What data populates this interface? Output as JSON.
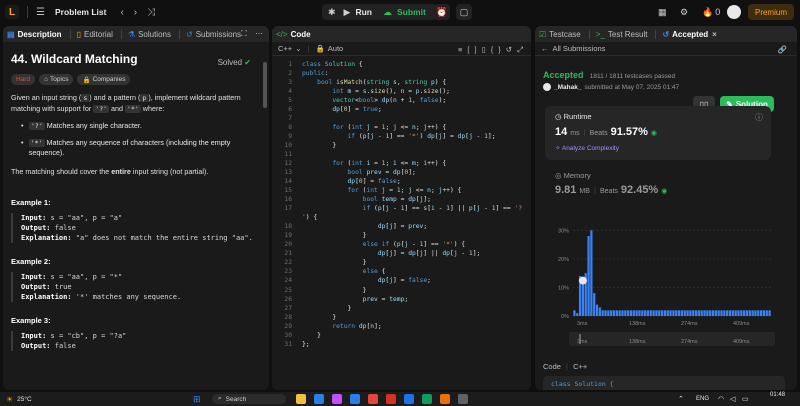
{
  "topbar": {
    "logo": "L",
    "title": "Problem List",
    "run": "Run",
    "submit": "Submit",
    "notif_count": "0",
    "premium": "Premium"
  },
  "description": {
    "tabs": [
      "Description",
      "Editorial",
      "Solutions",
      "Submissions"
    ],
    "title": "44. Wildcard Matching",
    "solved": "Solved",
    "chips": [
      "Hard",
      "Topics",
      "Companies"
    ],
    "intro_a": "Given an input string (",
    "intro_s": "s",
    "intro_b": ") and a pattern (",
    "intro_p": "p",
    "intro_c": "), implement wildcard pattern matching with support for ",
    "intro_q": "'?'",
    "intro_d": " and ",
    "intro_star": "'*'",
    "intro_e": " where:",
    "bullets": [
      {
        "code": "'?'",
        "text": " Matches any single character."
      },
      {
        "code": "'*'",
        "text": " Matches any sequence of characters (including the empty sequence)."
      }
    ],
    "cover_a": "The matching should cover the ",
    "cover_b": "entire",
    "cover_c": " input string (not partial).",
    "examples": [
      {
        "h": "Example 1:",
        "input": "s = \"aa\", p = \"a\"",
        "output": "false",
        "expl": "\"a\" does not match the entire string \"aa\"."
      },
      {
        "h": "Example 2:",
        "input": "s = \"aa\", p = \"*\"",
        "output": "true",
        "expl": "'*' matches any sequence."
      },
      {
        "h": "Example 3:",
        "input": "s = \"cb\", p = \"?a\"",
        "output": "false"
      }
    ],
    "labels": {
      "input": "Input:",
      "output": "Output:",
      "expl": "Explanation:"
    }
  },
  "code": {
    "tab": "Code",
    "lang": "C++",
    "auto": "Auto"
  },
  "result": {
    "tabs": [
      "Testcase",
      "Test Result",
      "Accepted"
    ],
    "back": "All Submissions",
    "status": "Accepted",
    "passed": "1811 / 1811 testcases passed",
    "user": "_Mahak_",
    "submitted": "submitted at May 07, 2025 01:47",
    "solution_btn": "Solution",
    "runtime_label": "Runtime",
    "runtime_val": "14",
    "runtime_unit": "ms",
    "beats": "Beats",
    "runtime_pct": "91.57%",
    "analyze": "Analyze Complexity",
    "memory_label": "Memory",
    "memory_val": "9.81",
    "memory_unit": "MB",
    "memory_pct": "92.45%",
    "yticks": [
      "30%",
      "20%",
      "10%",
      "0%"
    ],
    "xticks": [
      "3ms",
      "138ms",
      "274ms",
      "409ms"
    ],
    "xticks2": [
      "3ms",
      "138ms",
      "274ms",
      "409ms"
    ],
    "code_label": "Code",
    "code_lang": "C++",
    "code_preview": "class Solution {"
  },
  "chart_data": {
    "type": "bar",
    "x_label": "",
    "y_label": "",
    "ylim": [
      0,
      35
    ],
    "values": [
      2,
      1,
      14,
      11,
      15,
      28,
      30,
      8,
      4,
      3,
      2,
      2,
      2,
      2,
      2,
      2,
      2,
      2,
      2,
      2,
      2,
      2,
      2,
      2,
      2,
      2,
      2,
      2,
      2,
      2,
      2,
      2,
      2,
      2,
      2,
      2,
      2,
      2,
      2,
      2,
      2,
      2,
      2,
      2,
      2,
      2,
      2,
      2,
      2,
      2,
      2,
      2,
      2,
      2,
      2,
      2,
      2,
      2,
      2,
      2,
      2,
      2,
      2,
      2,
      2,
      2,
      2,
      2,
      2,
      2
    ]
  },
  "taskbar": {
    "weather": "25°C",
    "search": "Search",
    "lang": "ENG",
    "time": "01:48",
    "date": "07-05-2025"
  }
}
